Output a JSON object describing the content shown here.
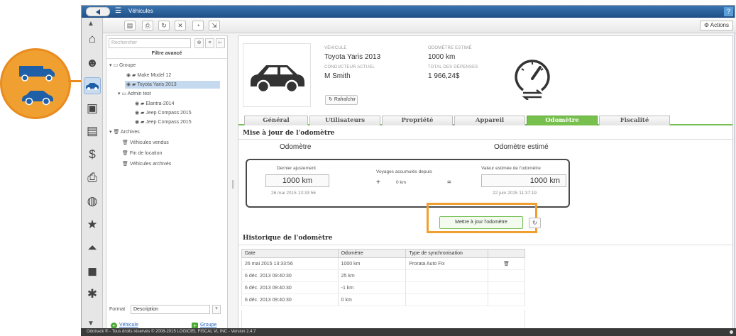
{
  "window": {
    "title": "Véhicules",
    "help": "?"
  },
  "toolbar": {
    "actions_label": "Actions"
  },
  "tree": {
    "search_placeholder": "Rechercher",
    "filter_label": "Filtre avancé",
    "items": [
      {
        "label": "Groupe"
      },
      {
        "label": "Make Model 12"
      },
      {
        "label": "Toyota Yaris 2013"
      },
      {
        "label": "Admin test"
      },
      {
        "label": "Elantra-2014"
      },
      {
        "label": "Jeep Compass 2015"
      },
      {
        "label": "Jeep Compass 2015"
      },
      {
        "label": "Archives"
      },
      {
        "label": "Véhicules vendus"
      },
      {
        "label": "Fin de location"
      },
      {
        "label": "Véhicules archivés"
      }
    ],
    "format_label": "Format",
    "format_value": "Description",
    "add_vehicle": "Véhicule",
    "add_group": "Groupe"
  },
  "vehicle": {
    "vehicle_label": "Véhicule",
    "vehicle_value": "Toyota Yaris 2013",
    "driver_label": "Conducteur actuel",
    "driver_value": "M Smith",
    "odo_label": "Odomètre estimé",
    "odo_value": "1000 km",
    "expenses_label": "Total des dépenses",
    "expenses_value": "1 966,24$",
    "refresh_label": "Rafraîchir"
  },
  "tabs": [
    {
      "label": "Général"
    },
    {
      "label": "Utilisateurs"
    },
    {
      "label": "Propriété"
    },
    {
      "label": "Appareil"
    },
    {
      "label": "Odomètre"
    },
    {
      "label": "Fiscalité"
    }
  ],
  "update": {
    "section_title": "Mise à jour de l'odomètre",
    "col_odo": "Odomètre",
    "col_estimated": "Odomètre estimé",
    "last_adjust_label": "Dernier ajustement",
    "last_adjust_value": "1000 km",
    "last_adjust_date": "26 mai 2015 13:33:56",
    "trips_label": "Voyages accumulés depuis",
    "trips_value": "0 km",
    "plus": "+",
    "equals": "=",
    "estimated_label": "Valeur estimée de l'odomètre",
    "estimated_value": "1000 km",
    "estimated_date": "22 juin 2015 11:37:19",
    "button_label": "Mettre à jour l'odomètre"
  },
  "history": {
    "section_title": "Historique de l'odomètre",
    "columns": [
      "Date",
      "Odomètre",
      "Type de synchronisation"
    ],
    "rows": [
      {
        "date": "26 mai 2015 13:33:56",
        "odo": "1000 km",
        "sync": "Prorata Auto Fix"
      },
      {
        "date": "6 déc. 2013 09:40:30",
        "odo": "25 km",
        "sync": ""
      },
      {
        "date": "6 déc. 2013 09:40:30",
        "odo": "-1 km",
        "sync": ""
      },
      {
        "date": "6 déc. 2013 09:40:30",
        "odo": "0 km",
        "sync": ""
      }
    ]
  },
  "footer": {
    "text": "Odotrack ® - Tous droits réservés © 2008-2015 LOGICIEL FISCAL VL INC - Version 2.4.7"
  },
  "colors": {
    "accent_green": "#78c04d",
    "highlight_orange": "#f0a030",
    "title_blue": "#2c5f97"
  }
}
